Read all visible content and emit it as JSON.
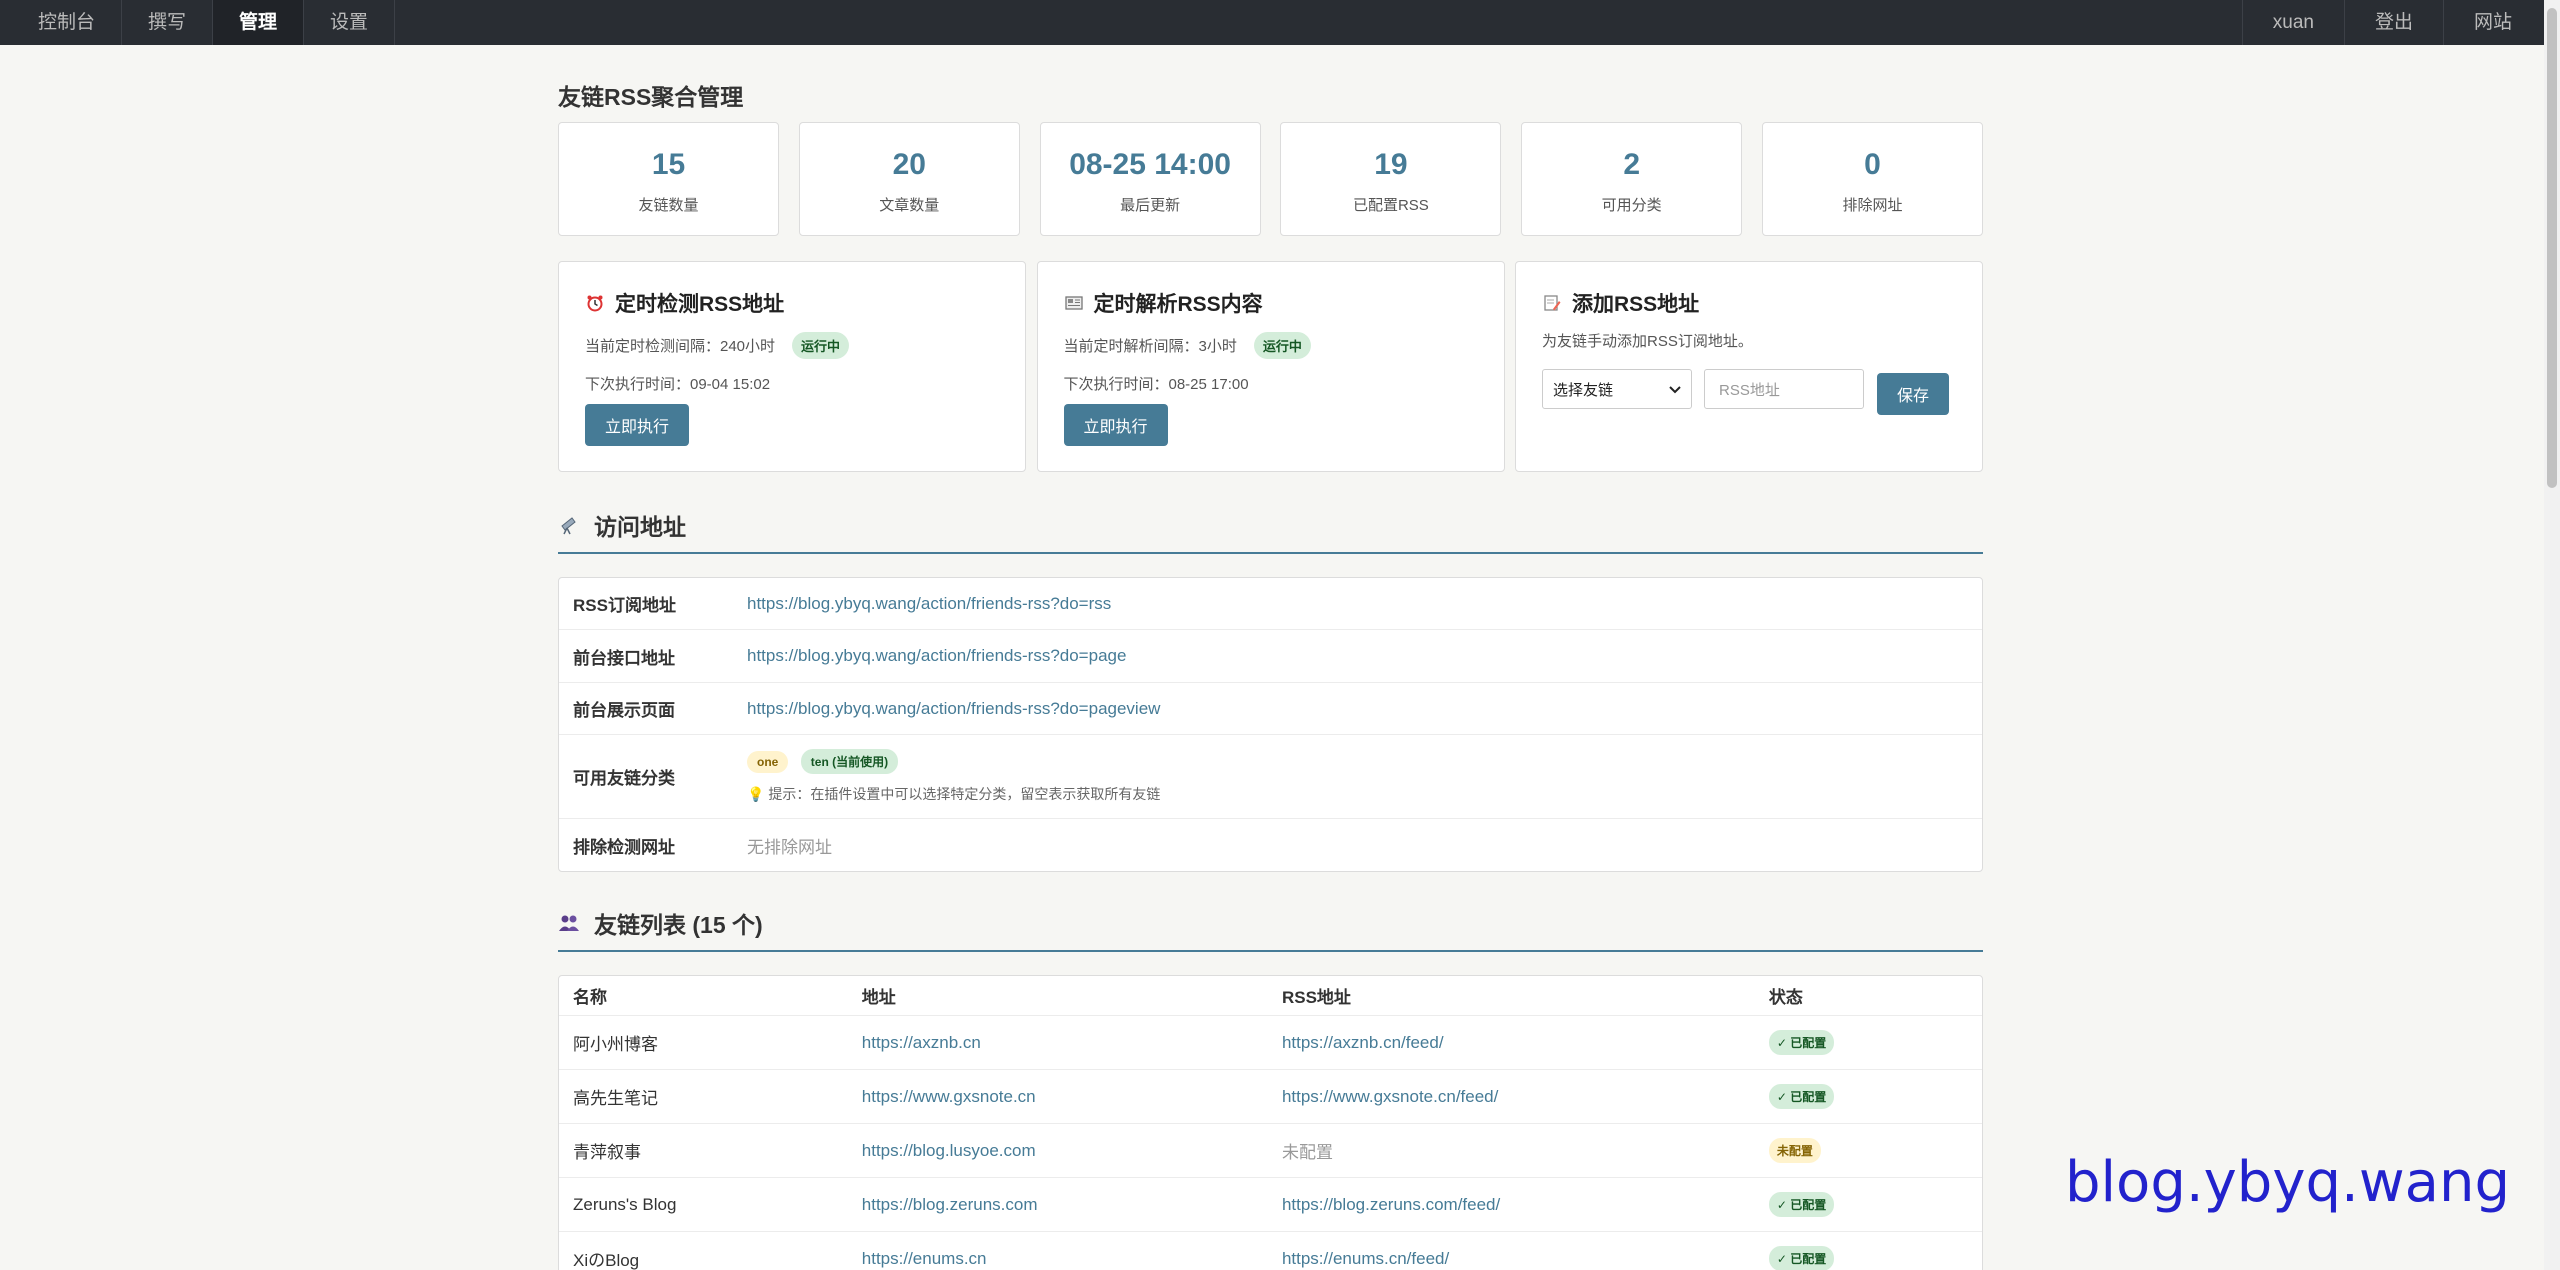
{
  "nav": {
    "left": [
      "控制台",
      "撰写",
      "管理",
      "设置"
    ],
    "active": "管理",
    "right": [
      "xuan",
      "登出",
      "网站"
    ]
  },
  "page_title": "友链RSS聚合管理",
  "stats": [
    {
      "value": "15",
      "label": "友链数量"
    },
    {
      "value": "20",
      "label": "文章数量"
    },
    {
      "value": "08-25 14:00",
      "label": "最后更新"
    },
    {
      "value": "19",
      "label": "已配置RSS"
    },
    {
      "value": "2",
      "label": "可用分类"
    },
    {
      "value": "0",
      "label": "排除网址"
    }
  ],
  "check_card": {
    "icon": "alarm-clock-icon",
    "title": "定时检测RSS地址",
    "interval": "当前定时检测间隔：240小时",
    "badge": "运行中",
    "next": "下次执行时间：09-04 15:02",
    "button": "立即执行"
  },
  "parse_card": {
    "icon": "newspaper-icon",
    "title": "定时解析RSS内容",
    "interval": "当前定时解析间隔：3小时",
    "badge": "运行中",
    "next": "下次执行时间：08-25 17:00",
    "button": "立即执行"
  },
  "add_card": {
    "icon": "memo-icon",
    "title": "添加RSS地址",
    "desc": "为友链手动添加RSS订阅地址。",
    "select_value": "选择友链",
    "input_placeholder": "RSS地址",
    "button": "保存"
  },
  "access": {
    "title": "访问地址",
    "rows": [
      {
        "key": "RSS订阅地址",
        "value": "https://blog.ybyq.wang/action/friends-rss?do=rss"
      },
      {
        "key": "前台接口地址",
        "value": "https://blog.ybyq.wang/action/friends-rss?do=page"
      },
      {
        "key": "前台展示页面",
        "value": "https://blog.ybyq.wang/action/friends-rss?do=pageview"
      }
    ],
    "categories_key": "可用友链分类",
    "categories": [
      "one",
      "ten (当前使用)"
    ],
    "hint": "💡 提示：在插件设置中可以选择特定分类，留空表示获取所有友链",
    "exclude_key": "排除检测网址",
    "exclude_value": "无排除网址"
  },
  "friends": {
    "title": "友链列表 (15 个)",
    "headers": [
      "名称",
      "地址",
      "RSS地址",
      "状态"
    ],
    "rows": [
      {
        "name": "阿小州博客",
        "url": "https://axznb.cn",
        "rss": "https://axznb.cn/feed/",
        "status": "✓ 已配置"
      },
      {
        "name": "高先生笔记",
        "url": "https://www.gxsnote.cn",
        "rss": "https://www.gxsnote.cn/feed/",
        "status": "✓ 已配置"
      },
      {
        "name": "青萍叙事",
        "url": "https://blog.lusyoe.com",
        "rss": "未配置",
        "status": "未配置"
      },
      {
        "name": "Zeruns's Blog",
        "url": "https://blog.zeruns.com",
        "rss": "https://blog.zeruns.com/feed/",
        "status": "✓ 已配置"
      },
      {
        "name": "XiのBlog",
        "url": "https://enums.cn",
        "rss": "https://enums.cn/feed/",
        "status": "✓ 已配置"
      }
    ]
  },
  "watermark": "blog.ybyq.wang",
  "colors": {
    "accent": "#467b96",
    "nav_bg": "#292d33",
    "ok_bg": "#d4edda",
    "warn_bg": "#fff3cd"
  }
}
